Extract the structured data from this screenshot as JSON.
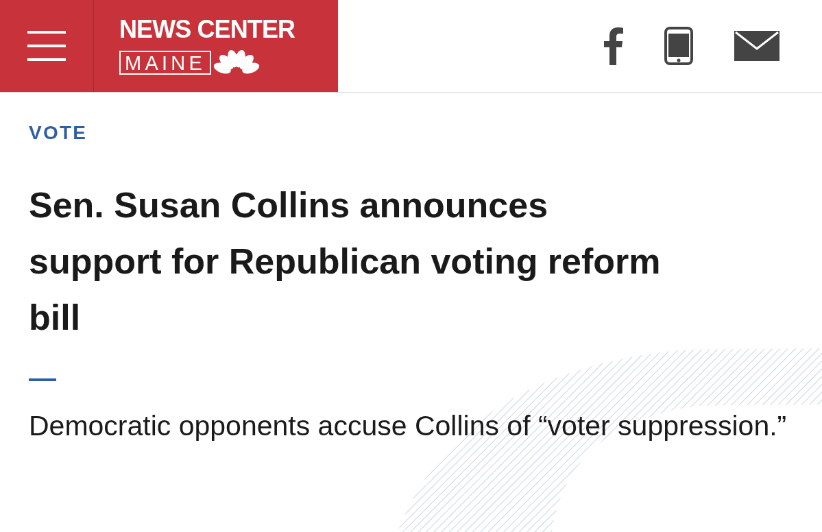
{
  "header": {
    "logo": {
      "line1": "NEWS CENTER",
      "line2": "MAINE"
    }
  },
  "article": {
    "section": "VOTE",
    "headline": "Sen. Susan Collins announces support for Republican voting reform bill",
    "subheadline": "Democratic opponents accuse Collins of “voter suppression.”"
  }
}
